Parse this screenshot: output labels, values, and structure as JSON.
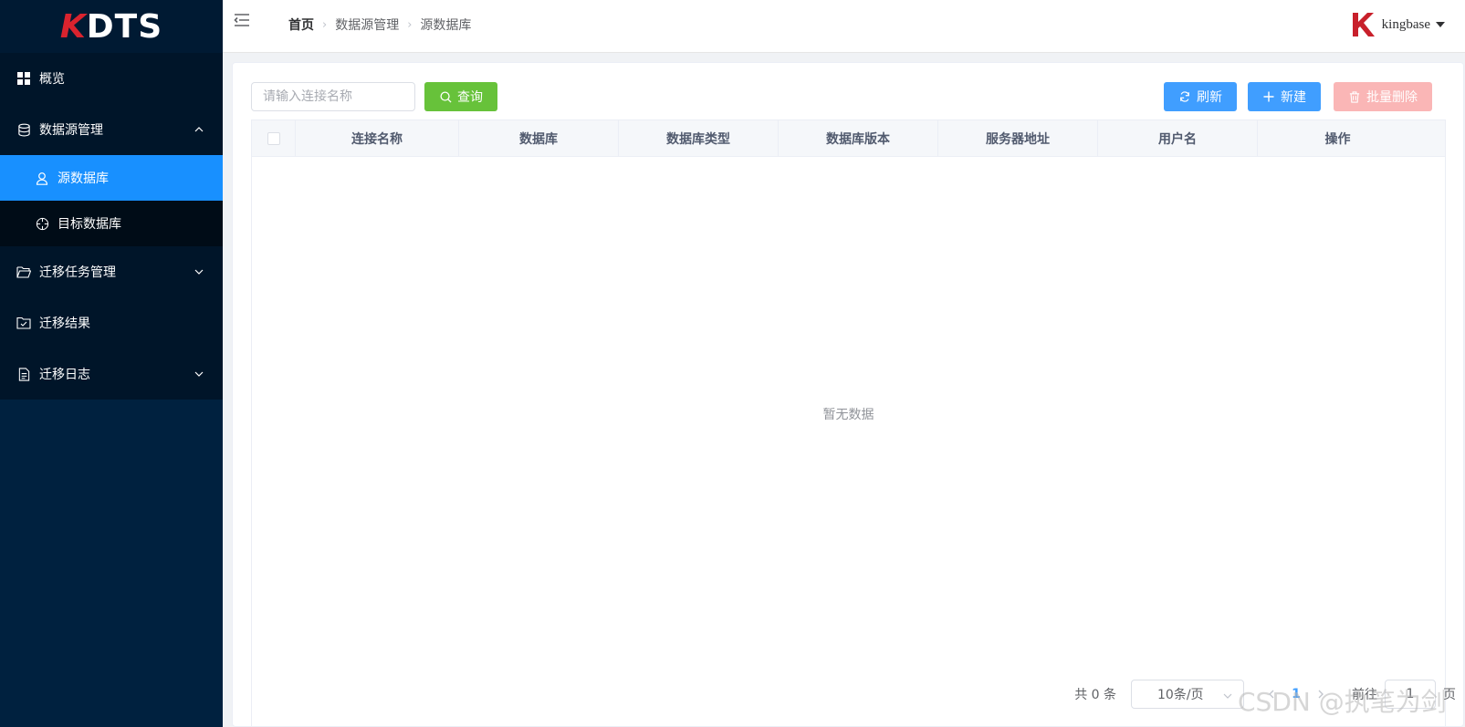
{
  "app": {
    "logo_prefix": "K",
    "logo_suffix": "DTS"
  },
  "sidebar": {
    "items": [
      {
        "label": "概览",
        "icon": "grid-icon"
      },
      {
        "label": "数据源管理",
        "icon": "database-icon",
        "expanded": true,
        "children": [
          {
            "label": "源数据库",
            "icon": "user-icon",
            "active": true
          },
          {
            "label": "目标数据库",
            "icon": "target-icon"
          }
        ]
      },
      {
        "label": "迁移任务管理",
        "icon": "folder-open-icon",
        "expanded": false
      },
      {
        "label": "迁移结果",
        "icon": "folder-check-icon"
      },
      {
        "label": "迁移日志",
        "icon": "document-icon",
        "expanded": false
      }
    ]
  },
  "header": {
    "breadcrumb": [
      "首页",
      "数据源管理",
      "源数据库"
    ],
    "user_name": "kingbase"
  },
  "toolbar": {
    "search_placeholder": "请输入连接名称",
    "query_label": "查询",
    "refresh_label": "刷新",
    "new_label": "新建",
    "batch_delete_label": "批量删除"
  },
  "table": {
    "columns": [
      "连接名称",
      "数据库",
      "数据库类型",
      "数据库版本",
      "服务器地址",
      "用户名",
      "操作"
    ],
    "rows": [],
    "empty_text": "暂无数据"
  },
  "pagination": {
    "total_text": "共 0 条",
    "page_size": "10条/页",
    "current_page": "1",
    "goto_label": "前往",
    "jump_value": "1",
    "page_unit": "页"
  },
  "colors": {
    "sidebar_bg": "#00213f",
    "active_bg": "#1890ff",
    "query_btn": "#67c23a",
    "primary_btn": "#409eff",
    "danger_disabled": "#fab6b6",
    "logo_red": "#d9232e"
  },
  "watermark": "CSDN @执笔为剑"
}
